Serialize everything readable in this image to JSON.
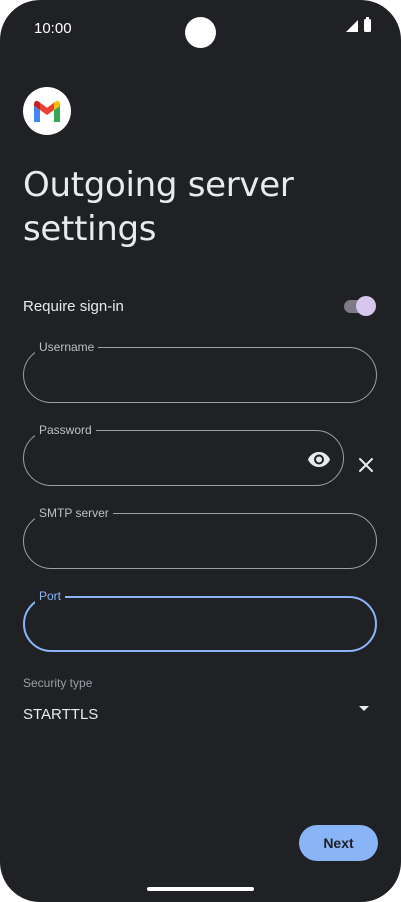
{
  "status_bar": {
    "time": "10:00",
    "icons": [
      "signal-icon",
      "battery-icon"
    ]
  },
  "app": {
    "logo_icon": "gmail-logo-icon"
  },
  "page": {
    "title": "Outgoing server settings"
  },
  "require_signin": {
    "label": "Require sign-in",
    "enabled": true
  },
  "fields": {
    "username": {
      "label": "Username",
      "value": ""
    },
    "password": {
      "label": "Password",
      "value": ""
    },
    "smtp_server": {
      "label": "SMTP server",
      "value": ""
    },
    "port": {
      "label": "Port",
      "value": "",
      "focused": true
    }
  },
  "security_type": {
    "label": "Security type",
    "value": "STARTTLS"
  },
  "actions": {
    "next_label": "Next"
  },
  "colors": {
    "background": "#202124",
    "accent": "#8ab4f8",
    "toggle_thumb": "#d7c7ee",
    "outline": "#9aa0a6"
  }
}
